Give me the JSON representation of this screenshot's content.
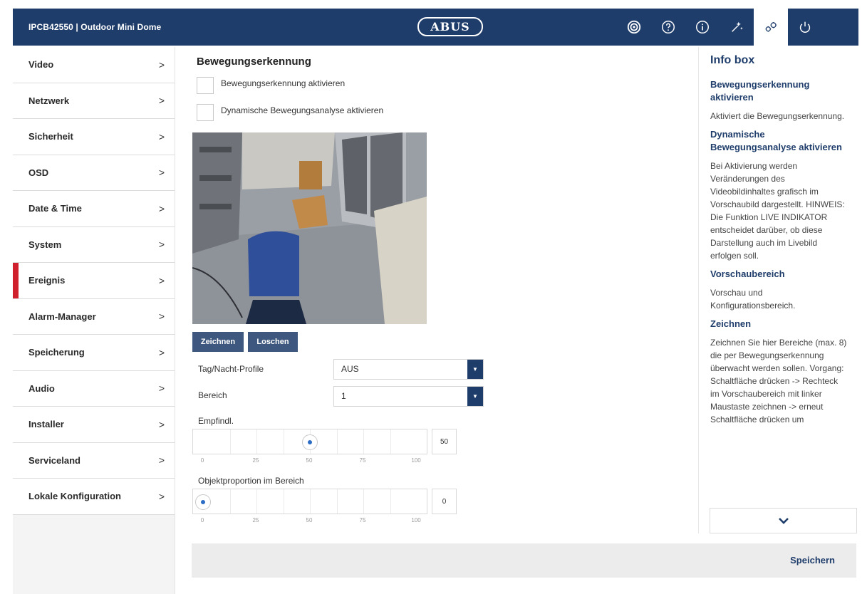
{
  "header": {
    "title": "IPCB42550 | Outdoor Mini Dome",
    "logo": "ABUS",
    "icons": [
      "live-view-icon",
      "help-icon",
      "info-icon",
      "wizard-icon",
      "settings-icon",
      "power-icon"
    ],
    "active_icon": "settings-icon"
  },
  "sidebar": {
    "items": [
      {
        "label": "Video"
      },
      {
        "label": "Netzwerk"
      },
      {
        "label": "Sicherheit"
      },
      {
        "label": "OSD"
      },
      {
        "label": "Date & Time"
      },
      {
        "label": "System"
      },
      {
        "label": "Ereignis",
        "active": true
      },
      {
        "label": "Alarm-Manager"
      },
      {
        "label": "Speicherung"
      },
      {
        "label": "Audio"
      },
      {
        "label": "Installer"
      },
      {
        "label": "Serviceland"
      },
      {
        "label": "Lokale Konfiguration"
      }
    ],
    "chevron": ">"
  },
  "main": {
    "title": "Bewegungserkennung",
    "checkboxes": [
      {
        "label": "Bewegungserkennung aktivieren",
        "checked": false
      },
      {
        "label": "Dynamische Bewegungsanalyse aktivieren",
        "checked": false
      }
    ],
    "buttons": {
      "draw": "Zeichnen",
      "delete": "Loschen"
    },
    "day_night": {
      "label": "Tag/Nacht-Profile",
      "value": "AUS"
    },
    "area": {
      "label": "Bereich",
      "value": "1"
    },
    "sensitivity": {
      "label": "Empfindl.",
      "value": 50,
      "display": "50",
      "scale": [
        "0",
        "25",
        "50",
        "75",
        "100"
      ]
    },
    "object_ratio": {
      "label": "Objektproportion im Bereich",
      "value": 0,
      "display": "0",
      "scale": [
        "0",
        "25",
        "50",
        "75",
        "100"
      ]
    },
    "save": "Speichern"
  },
  "info": {
    "title": "Info box",
    "sections": [
      {
        "heading": "Bewegungserkennung aktivieren",
        "text": "Aktiviert die Bewegungserkennung."
      },
      {
        "heading": "Dynamische Bewegungsanalyse aktivieren",
        "text": "Bei Aktivierung werden Veränderungen des Videobildinhaltes grafisch im Vorschaubild dargestellt. HINWEIS: Die Funktion LIVE INDIKATOR entscheidet darüber, ob diese Darstellung auch im Livebild erfolgen soll."
      },
      {
        "heading": "Vorschaubereich",
        "text": "Vorschau und Konfigurationsbereich."
      },
      {
        "heading": "Zeichnen",
        "text": "Zeichnen Sie hier Bereiche (max. 8) die per Bewegungserkennung überwacht werden sollen. Vorgang: Schaltfläche drücken -> Rechteck im Vorschaubereich mit linker Maustaste zeichnen -> erneut Schaltfläche drücken um"
      }
    ],
    "scroll_icon": "chevron-down-icon"
  }
}
